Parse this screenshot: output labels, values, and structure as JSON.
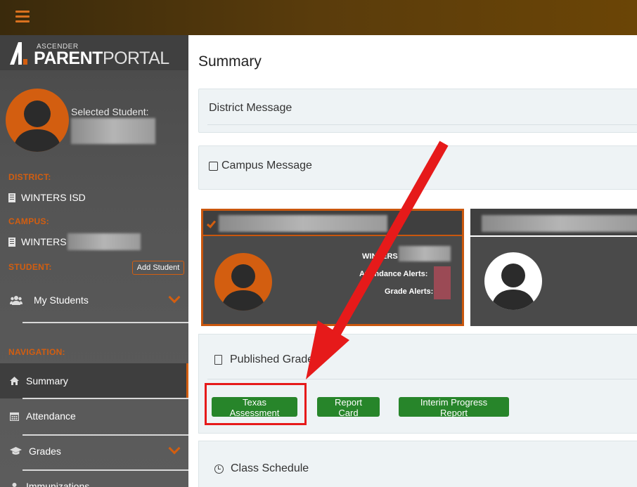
{
  "header": {
    "menu_icon": "hamburger-icon"
  },
  "logo": {
    "small": "ASCENDER",
    "bold": "PARENT",
    "light": "PORTAL"
  },
  "sidebar": {
    "selected_label": "Selected Student:",
    "district_label": "DISTRICT:",
    "district_value": "WINTERS ISD",
    "campus_label": "CAMPUS:",
    "campus_value": "WINTERS",
    "student_label": "STUDENT:",
    "add_student": "Add Student",
    "my_students": "My Students",
    "navigation_label": "NAVIGATION:",
    "nav": [
      {
        "label": "Summary",
        "icon": "home-icon",
        "active": true
      },
      {
        "label": "Attendance",
        "icon": "calendar-icon"
      },
      {
        "label": "Grades",
        "icon": "graduation-cap-icon"
      },
      {
        "label": "Immunizations",
        "icon": "user-icon"
      }
    ]
  },
  "main": {
    "title": "Summary",
    "district_message": "District Message",
    "campus_message": "Campus Message",
    "card1": {
      "campus": "WINTERS",
      "attendance_alerts": "Attendance Alerts:",
      "grade_alerts": "Grade Alerts:"
    },
    "published_grades": "Published Grades",
    "buttons": {
      "texas_assessment": "Texas Assessment",
      "report_card": "Report Card",
      "interim_progress": "Interim Progress Report"
    },
    "class_schedule": "Class Schedule"
  },
  "colors": {
    "accent": "#d35e10",
    "green": "#27852a",
    "annotation_red": "#e61a1a"
  }
}
